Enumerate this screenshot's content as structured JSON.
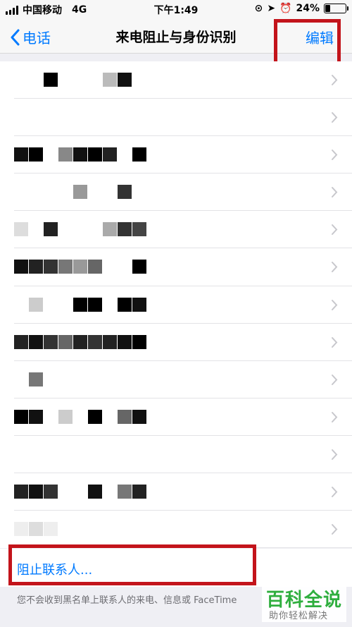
{
  "status_bar": {
    "carrier": "中国移动",
    "network": "4G",
    "time": "下午1:49",
    "battery": "24%",
    "battery_level": 0.24
  },
  "nav": {
    "back_label": "电话",
    "title": "来电阻止与身份识别",
    "edit_label": "编辑"
  },
  "blocked_rows": [
    {
      "text": ""
    },
    {
      "text": ""
    },
    {
      "text": ""
    },
    {
      "text": ""
    },
    {
      "text": ""
    },
    {
      "text": ""
    },
    {
      "text": ""
    },
    {
      "text": ""
    },
    {
      "text": ""
    },
    {
      "text": ""
    },
    {
      "text": ""
    },
    {
      "text": ""
    },
    {
      "text": ""
    }
  ],
  "block_contact_label": "阻止联系人...",
  "footer_note": "您不会收到黑名单上联系人的来电、信息或 FaceTime",
  "watermark": {
    "title": "百科全说",
    "subtitle": "助你轻松解决"
  },
  "colors": {
    "accent": "#007aff",
    "highlight": "#c3141b",
    "watermark": "#2fae3e"
  }
}
